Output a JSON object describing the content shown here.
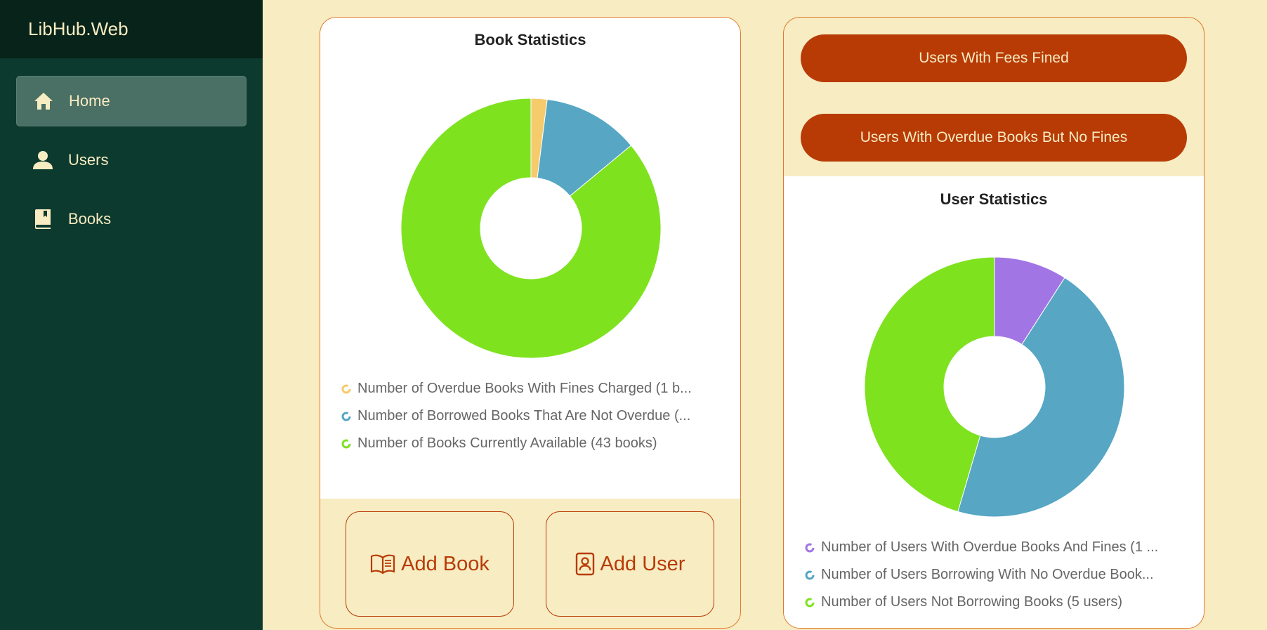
{
  "app": {
    "title": "LibHub.Web"
  },
  "sidebar": {
    "items": [
      {
        "label": "Home",
        "icon": "home-icon",
        "active": true
      },
      {
        "label": "Users",
        "icon": "user-icon",
        "active": false
      },
      {
        "label": "Books",
        "icon": "book-icon",
        "active": false
      }
    ]
  },
  "book_stats": {
    "title": "Book Statistics",
    "legend": [
      {
        "label": "Number of Overdue Books With Fines Charged (1 b...",
        "color": "#f5cb6b"
      },
      {
        "label": "Number of Borrowed Books That Are Not Overdue (...",
        "color": "#56a6c4"
      },
      {
        "label": "Number of Books Currently Available (43 books)",
        "color": "#7ee21f"
      }
    ],
    "add_book_label": "Add Book",
    "add_user_label": "Add User"
  },
  "user_stats": {
    "fees_button": "Users With Fees Fined",
    "overdue_button": "Users With Overdue Books But No Fines",
    "title": "User Statistics",
    "legend": [
      {
        "label": "Number of Users With Overdue Books And Fines (1 ...",
        "color": "#a275e4"
      },
      {
        "label": "Number of Users Borrowing With No Overdue Book...",
        "color": "#56a6c4"
      },
      {
        "label": "Number of Users Not Borrowing Books (5 users)",
        "color": "#7ee21f"
      }
    ]
  },
  "chart_data": [
    {
      "type": "pie",
      "title": "Book Statistics",
      "categories": [
        "Number of Overdue Books With Fines Charged (1 b...",
        "Number of Borrowed Books That Are Not Overdue (...",
        "Number of Books Currently Available (43 books)"
      ],
      "values": [
        1,
        6,
        43
      ],
      "colors": [
        "#f5cb6b",
        "#56a6c4",
        "#7ee21f"
      ],
      "legend": "bottom"
    },
    {
      "type": "pie",
      "title": "User Statistics",
      "categories": [
        "Number of Users With Overdue Books And Fines (1 ...",
        "Number of Users Borrowing With No Overdue Book...",
        "Number of Users Not Borrowing Books (5 users)"
      ],
      "values": [
        1,
        5,
        5
      ],
      "colors": [
        "#a275e4",
        "#56a6c4",
        "#7ee21f"
      ],
      "legend": "bottom"
    }
  ]
}
